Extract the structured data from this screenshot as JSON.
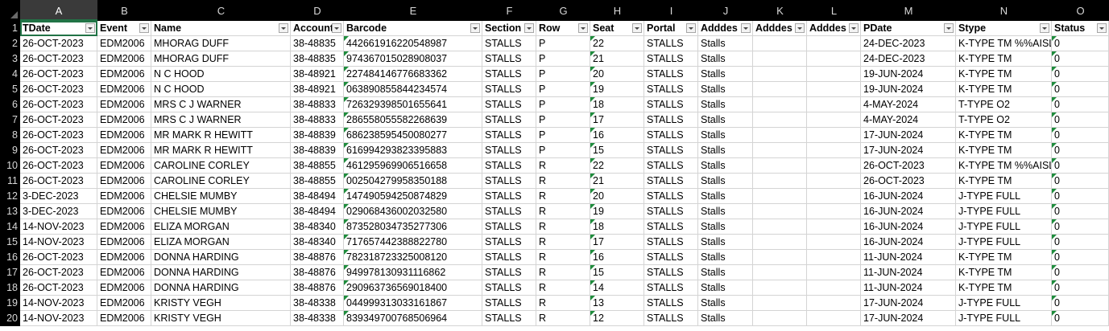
{
  "column_letters": [
    "A",
    "B",
    "C",
    "D",
    "E",
    "F",
    "G",
    "H",
    "I",
    "J",
    "K",
    "L",
    "M",
    "N",
    "O"
  ],
  "headers": [
    "TDate",
    "Event",
    "Name",
    "Account",
    "Barcode",
    "Section",
    "Row",
    "Seat",
    "Portal",
    "Adddes",
    "Adddes",
    "Adddes",
    "PDate",
    "Stype",
    "Status"
  ],
  "rows": [
    {
      "n": "2",
      "cells": [
        "26-OCT-2023",
        "EDM2006",
        "MHORAG DUFF",
        "38-48835",
        "442661916220548987",
        "STALLS",
        "P",
        "22",
        "STALLS",
        "Stalls",
        "",
        "",
        "24-DEC-2023",
        "K-TYPE TM %%AISLE",
        "0"
      ]
    },
    {
      "n": "3",
      "cells": [
        "26-OCT-2023",
        "EDM2006",
        "MHORAG DUFF",
        "38-48835",
        "974367015028908037",
        "STALLS",
        "P",
        "21",
        "STALLS",
        "Stalls",
        "",
        "",
        "24-DEC-2023",
        "K-TYPE TM",
        "0"
      ]
    },
    {
      "n": "4",
      "cells": [
        "26-OCT-2023",
        "EDM2006",
        "N C HOOD",
        "38-48921",
        "227484146776683362",
        "STALLS",
        "P",
        "20",
        "STALLS",
        "Stalls",
        "",
        "",
        "19-JUN-2024",
        "K-TYPE TM",
        "0"
      ]
    },
    {
      "n": "5",
      "cells": [
        "26-OCT-2023",
        "EDM2006",
        "N C HOOD",
        "38-48921",
        "063890855844234574",
        "STALLS",
        "P",
        "19",
        "STALLS",
        "Stalls",
        "",
        "",
        "19-JUN-2024",
        "K-TYPE TM",
        "0"
      ]
    },
    {
      "n": "6",
      "cells": [
        "26-OCT-2023",
        "EDM2006",
        "MRS C J WARNER",
        "38-48833",
        "726329398501655641",
        "STALLS",
        "P",
        "18",
        "STALLS",
        "Stalls",
        "",
        "",
        "4-MAY-2024",
        "T-TYPE O2",
        "0"
      ]
    },
    {
      "n": "7",
      "cells": [
        "26-OCT-2023",
        "EDM2006",
        "MRS C J WARNER",
        "38-48833",
        "286558055582268639",
        "STALLS",
        "P",
        "17",
        "STALLS",
        "Stalls",
        "",
        "",
        "4-MAY-2024",
        "T-TYPE O2",
        "0"
      ]
    },
    {
      "n": "8",
      "cells": [
        "26-OCT-2023",
        "EDM2006",
        "MR MARK R HEWITT",
        "38-48839",
        "686238595450080277",
        "STALLS",
        "P",
        "16",
        "STALLS",
        "Stalls",
        "",
        "",
        "17-JUN-2024",
        "K-TYPE TM",
        "0"
      ]
    },
    {
      "n": "9",
      "cells": [
        "26-OCT-2023",
        "EDM2006",
        "MR MARK R HEWITT",
        "38-48839",
        "616994293823395883",
        "STALLS",
        "P",
        "15",
        "STALLS",
        "Stalls",
        "",
        "",
        "17-JUN-2024",
        "K-TYPE TM",
        "0"
      ]
    },
    {
      "n": "10",
      "cells": [
        "26-OCT-2023",
        "EDM2006",
        "CAROLINE CORLEY",
        "38-48855",
        "461295969906516658",
        "STALLS",
        "R",
        "22",
        "STALLS",
        "Stalls",
        "",
        "",
        "26-OCT-2023",
        "K-TYPE TM %%AISLE",
        "0"
      ]
    },
    {
      "n": "11",
      "cells": [
        "26-OCT-2023",
        "EDM2006",
        "CAROLINE CORLEY",
        "38-48855",
        "002504279958350188",
        "STALLS",
        "R",
        "21",
        "STALLS",
        "Stalls",
        "",
        "",
        "26-OCT-2023",
        "K-TYPE TM",
        "0"
      ]
    },
    {
      "n": "12",
      "cells": [
        "3-DEC-2023",
        "EDM2006",
        "CHELSIE MUMBY",
        "38-48494",
        "147490594250874829",
        "STALLS",
        "R",
        "20",
        "STALLS",
        "Stalls",
        "",
        "",
        "16-JUN-2024",
        "J-TYPE FULL",
        "0"
      ]
    },
    {
      "n": "13",
      "cells": [
        "3-DEC-2023",
        "EDM2006",
        "CHELSIE MUMBY",
        "38-48494",
        "029068436002032580",
        "STALLS",
        "R",
        "19",
        "STALLS",
        "Stalls",
        "",
        "",
        "16-JUN-2024",
        "J-TYPE FULL",
        "0"
      ]
    },
    {
      "n": "14",
      "cells": [
        "14-NOV-2023",
        "EDM2006",
        "ELIZA MORGAN",
        "38-48340",
        "873528034735277306",
        "STALLS",
        "R",
        "18",
        "STALLS",
        "Stalls",
        "",
        "",
        "16-JUN-2024",
        "J-TYPE FULL",
        "0"
      ]
    },
    {
      "n": "15",
      "cells": [
        "14-NOV-2023",
        "EDM2006",
        "ELIZA MORGAN",
        "38-48340",
        "717657442388822780",
        "STALLS",
        "R",
        "17",
        "STALLS",
        "Stalls",
        "",
        "",
        "16-JUN-2024",
        "J-TYPE FULL",
        "0"
      ]
    },
    {
      "n": "16",
      "cells": [
        "26-OCT-2023",
        "EDM2006",
        "DONNA HARDING",
        "38-48876",
        "782318723325008120",
        "STALLS",
        "R",
        "16",
        "STALLS",
        "Stalls",
        "",
        "",
        "11-JUN-2024",
        "K-TYPE TM",
        "0"
      ]
    },
    {
      "n": "17",
      "cells": [
        "26-OCT-2023",
        "EDM2006",
        "DONNA HARDING",
        "38-48876",
        "949978130931116862",
        "STALLS",
        "R",
        "15",
        "STALLS",
        "Stalls",
        "",
        "",
        "11-JUN-2024",
        "K-TYPE TM",
        "0"
      ]
    },
    {
      "n": "18",
      "cells": [
        "26-OCT-2023",
        "EDM2006",
        "DONNA HARDING",
        "38-48876",
        "290963736569018400",
        "STALLS",
        "R",
        "14",
        "STALLS",
        "Stalls",
        "",
        "",
        "11-JUN-2024",
        "K-TYPE TM",
        "0"
      ]
    },
    {
      "n": "19",
      "cells": [
        "14-NOV-2023",
        "EDM2006",
        "KRISTY VEGH",
        "38-48338",
        "044999313033161867",
        "STALLS",
        "R",
        "13",
        "STALLS",
        "Stalls",
        "",
        "",
        "17-JUN-2024",
        "J-TYPE FULL",
        "0"
      ]
    },
    {
      "n": "20",
      "cells": [
        "14-NOV-2023",
        "EDM2006",
        "KRISTY VEGH",
        "38-48338",
        "839349700768506964",
        "STALLS",
        "R",
        "12",
        "STALLS",
        "Stalls",
        "",
        "",
        "17-JUN-2024",
        "J-TYPE FULL",
        "0"
      ]
    }
  ],
  "header_row_number": "1",
  "text_stored_columns": [
    "Barcode",
    "Seat",
    "Status"
  ],
  "colors": {
    "header_bg": "#000000",
    "header_text": "#d8d8d8",
    "selection": "#217346",
    "error_indicator": "#1e8c3c",
    "gridline": "#d4d4d4"
  },
  "icons": {
    "filter": "filter-dropdown-icon",
    "select_all": "select-all-corner-icon",
    "error": "text-number-indicator-icon"
  }
}
